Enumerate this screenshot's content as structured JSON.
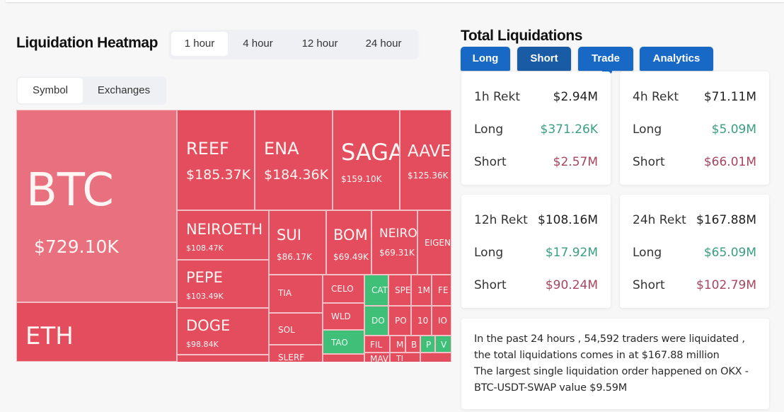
{
  "heatmap": {
    "title": "Liquidation Heatmap",
    "time_tabs": [
      {
        "label": "1 hour",
        "active": true
      },
      {
        "label": "4 hour",
        "active": false
      },
      {
        "label": "12 hour",
        "active": false
      },
      {
        "label": "24 hour",
        "active": false
      }
    ],
    "view_tabs": [
      {
        "label": "Symbol",
        "active": true
      },
      {
        "label": "Exchanges",
        "active": false
      }
    ],
    "colors": {
      "loss_red": "#e34d5e",
      "btc_pink": "#e9707e",
      "gain_green": "#3fbf78"
    },
    "tiles": [
      {
        "symbol": "BTC",
        "value": "$729.10K",
        "color": "pink"
      },
      {
        "symbol": "ETH",
        "value": "",
        "color": "red"
      },
      {
        "symbol": "REEF",
        "value": "$185.37K",
        "color": "red"
      },
      {
        "symbol": "ENA",
        "value": "$184.36K",
        "color": "red"
      },
      {
        "symbol": "SAGA",
        "value": "$159.10K",
        "color": "red"
      },
      {
        "symbol": "AAVE",
        "value": "$125.36K",
        "color": "red"
      },
      {
        "symbol": "NEIROETH",
        "value": "$108.47K",
        "color": "red"
      },
      {
        "symbol": "SUI",
        "value": "$86.17K",
        "color": "red"
      },
      {
        "symbol": "BOM",
        "value": "$69.49K",
        "color": "red"
      },
      {
        "symbol": "NEIRO",
        "value": "$69.31K",
        "color": "red"
      },
      {
        "symbol": "EIGEN",
        "value": "",
        "color": "red"
      },
      {
        "symbol": "PEPE",
        "value": "$103.49K",
        "color": "red"
      },
      {
        "symbol": "DOGE",
        "value": "$98.84K",
        "color": "red"
      },
      {
        "symbol": "TIA",
        "value": "",
        "color": "red"
      },
      {
        "symbol": "SOL",
        "value": "",
        "color": "red"
      },
      {
        "symbol": "SLERF",
        "value": "",
        "color": "red"
      },
      {
        "symbol": "CELO",
        "value": "",
        "color": "red"
      },
      {
        "symbol": "WLD",
        "value": "",
        "color": "red"
      },
      {
        "symbol": "TAO",
        "value": "",
        "color": "green"
      },
      {
        "symbol": "CAT",
        "value": "",
        "color": "green"
      },
      {
        "symbol": "DO",
        "value": "",
        "color": "green"
      },
      {
        "symbol": "SPE",
        "value": "",
        "color": "red"
      },
      {
        "symbol": "PO",
        "value": "",
        "color": "red"
      },
      {
        "symbol": "1M",
        "value": "",
        "color": "red"
      },
      {
        "symbol": "10",
        "value": "",
        "color": "red"
      },
      {
        "symbol": "FE",
        "value": "",
        "color": "red"
      },
      {
        "symbol": "IO",
        "value": "",
        "color": "red"
      },
      {
        "symbol": "FIL",
        "value": "",
        "color": "red"
      },
      {
        "symbol": "MAV",
        "value": "",
        "color": "red"
      },
      {
        "symbol": "M",
        "value": "",
        "color": "red"
      },
      {
        "symbol": "B",
        "value": "",
        "color": "red"
      },
      {
        "symbol": "P",
        "value": "",
        "color": "green"
      },
      {
        "symbol": "V",
        "value": "",
        "color": "green"
      },
      {
        "symbol": "TI",
        "value": "",
        "color": "red"
      }
    ]
  },
  "totals": {
    "title": "Total Liquidations",
    "buttons": [
      {
        "label": "Long",
        "active": false
      },
      {
        "label": "Short",
        "active": true
      },
      {
        "label": "Trade",
        "active": false
      },
      {
        "label": "Analytics",
        "active": false
      }
    ],
    "colors": {
      "button_blue": "#1769c5",
      "long_green": "#3a9e82",
      "short_red": "#a7445f"
    },
    "cards": [
      {
        "period": "1h Rekt",
        "total": "$2.94M",
        "long_label": "Long",
        "long": "$371.26K",
        "short_label": "Short",
        "short": "$2.57M"
      },
      {
        "period": "4h Rekt",
        "total": "$71.11M",
        "long_label": "Long",
        "long": "$5.09M",
        "short_label": "Short",
        "short": "$66.01M"
      },
      {
        "period": "12h Rekt",
        "total": "$108.16M",
        "long_label": "Long",
        "long": "$17.92M",
        "short_label": "Short",
        "short": "$90.24M"
      },
      {
        "period": "24h Rekt",
        "total": "$167.88M",
        "long_label": "Long",
        "long": "$65.09M",
        "short_label": "Short",
        "short": "$102.79M"
      }
    ],
    "summary_lines": [
      "In the past 24 hours , 54,592 traders were liquidated , the total liquidations comes in at $167.88 million",
      "The largest single liquidation order happened on OKX - BTC-USDT-SWAP value $9.59M"
    ]
  }
}
